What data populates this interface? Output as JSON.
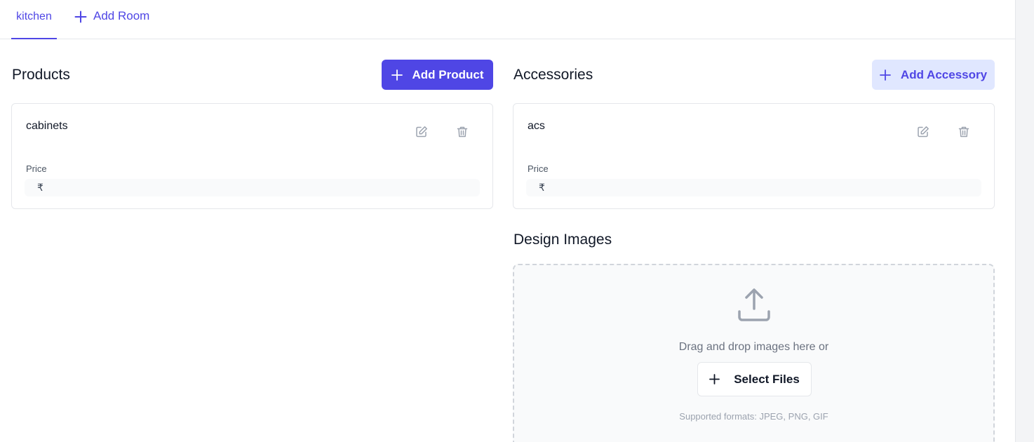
{
  "tabs": {
    "rooms": [
      {
        "label": "kitchen"
      }
    ],
    "add_room_label": "Add Room"
  },
  "products": {
    "title": "Products",
    "add_label": "Add Product",
    "items": [
      {
        "name": "cabinets",
        "price_label": "Price",
        "currency": "₹",
        "price": ""
      }
    ]
  },
  "accessories": {
    "title": "Accessories",
    "add_label": "Add Accessory",
    "items": [
      {
        "name": "acs",
        "price_label": "Price",
        "currency": "₹",
        "price": ""
      }
    ]
  },
  "design_images": {
    "title": "Design Images",
    "drop_text": "Drag and drop images here or",
    "select_label": "Select Files",
    "formats_text": "Supported formats: JPEG, PNG, GIF"
  },
  "colors": {
    "accent": "#4f46e5",
    "accent_soft": "#e0e7ff",
    "border": "#e5e7eb",
    "muted_text": "#6b7280"
  },
  "icons": [
    "plus-icon",
    "edit-icon",
    "trash-icon",
    "upload-icon"
  ]
}
